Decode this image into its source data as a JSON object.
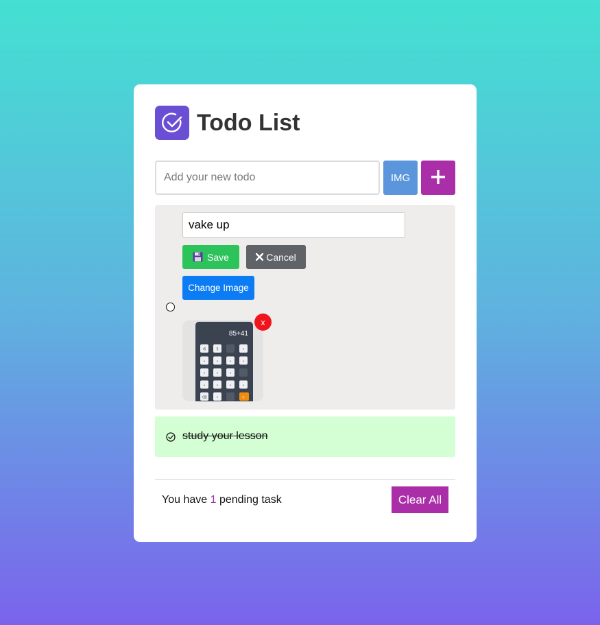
{
  "app": {
    "title": "Todo List",
    "logo_icon": "check-circle-icon"
  },
  "colors": {
    "background_top": "#44e0d2",
    "background_bottom": "#7b63ec",
    "accent": "#aa2ea8",
    "logo": "#6a4fd4",
    "save": "#2cc35a",
    "cancel": "#5f6368",
    "change_image": "#0b7cf3",
    "img_button": "#5b95dc",
    "remove": "#f2141c",
    "completed_task_bg": "#d4ffd4"
  },
  "new_todo": {
    "placeholder": "Add your new todo",
    "value": "",
    "img_button_label": "IMG",
    "add_button_icon": "plus-icon"
  },
  "tasks": [
    {
      "mode": "editing",
      "completed": false,
      "edit_value": "vake up",
      "save_label": "Save",
      "save_icon": "floppy-disk-icon",
      "cancel_label": "Cancel",
      "cancel_icon": "x-icon",
      "change_image_label": "Change Image",
      "remove_image_label": "x",
      "image": {
        "type": "calculator-screenshot",
        "display": "85+41",
        "keys": [
          "•5",
          "5",
          "",
          "•",
          "•",
          "•",
          "•",
          "•",
          "•",
          "•",
          "•",
          "",
          "•",
          "•",
          "•",
          "•",
          "⌫",
          "•",
          "",
          "="
        ]
      }
    },
    {
      "mode": "view",
      "completed": true,
      "text": "study your lesson",
      "icon": "check-circle-icon"
    }
  ],
  "footer": {
    "prefix": "You have",
    "count": "1",
    "suffix": "pending task",
    "clear_label": "Clear All"
  }
}
